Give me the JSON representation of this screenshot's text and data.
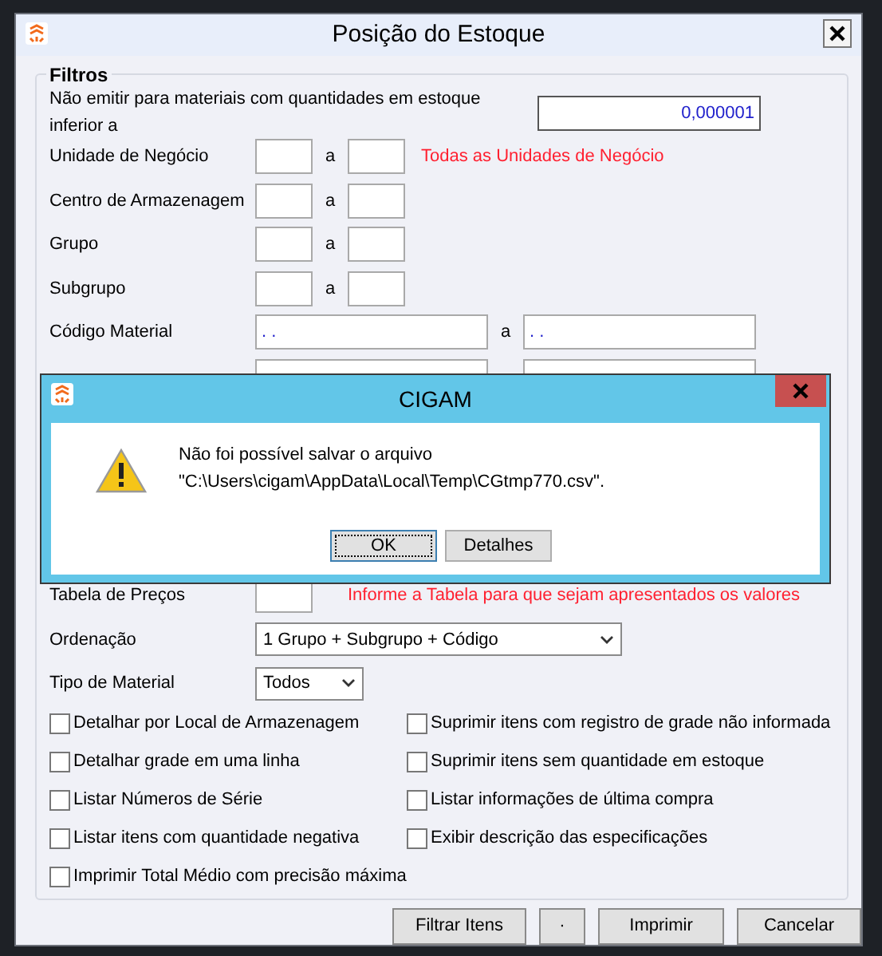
{
  "window": {
    "title": "Posição do Estoque"
  },
  "filters": {
    "legend": "Filtros",
    "min_qty": {
      "label": "Não emitir para materiais com quantidades em estoque inferior a",
      "value": "0,000001"
    },
    "ranges": [
      {
        "label": "Unidade de Negócio",
        "kind": "short",
        "separator": "a",
        "note": "Todas as Unidades de Negócio"
      },
      {
        "label": "Centro de Armazenagem",
        "kind": "short",
        "separator": "a"
      },
      {
        "label": "Grupo",
        "kind": "short",
        "separator": "a"
      },
      {
        "label": "Subgrupo",
        "kind": "short",
        "separator": "a"
      },
      {
        "label": "Código Material",
        "kind": "long",
        "from": ". .",
        "to": ". .",
        "separator": "a"
      },
      {
        "kind": "long"
      }
    ],
    "price_table": {
      "label": "Tabela de Preços",
      "note": "Informe a Tabela para que sejam apresentados os valores"
    },
    "ordering": {
      "label": "Ordenação",
      "value": "1 Grupo + Subgrupo + Código"
    },
    "material_type": {
      "label": "Tipo de Material",
      "value": "Todos"
    },
    "checks_left": [
      {
        "label": "Detalhar por Local de Armazenagem",
        "checked": false
      },
      {
        "label": "Detalhar grade em uma linha",
        "checked": false
      },
      {
        "label": "Listar Números de Série",
        "checked": false
      },
      {
        "label": "Listar itens com quantidade negativa",
        "checked": false
      },
      {
        "label": "Imprimir Total Médio com precisão máxima",
        "checked": false
      }
    ],
    "checks_right": [
      {
        "label": "Suprimir itens com registro de grade não informada",
        "checked": false
      },
      {
        "label": "Suprimir itens sem quantidade em estoque",
        "checked": false
      },
      {
        "label": "Listar informações de última compra",
        "checked": false
      },
      {
        "label": "Exibir descrição das especificações",
        "checked": false
      }
    ]
  },
  "buttons": [
    "Filtrar Itens",
    "·",
    "Imprimir",
    "Cancelar"
  ],
  "dialog": {
    "title": "CIGAM",
    "message": [
      "Não foi possível salvar o arquivo",
      "\"C:\\Users\\cigam\\AppData\\Local\\Temp\\CGtmp770.csv\"."
    ],
    "buttons": [
      {
        "label": "OK",
        "focused": true
      },
      {
        "label": "Detalhes",
        "focused": false
      }
    ]
  }
}
